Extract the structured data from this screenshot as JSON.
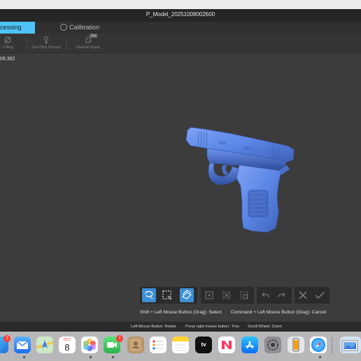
{
  "window": {
    "title": "P_Model_20251008002600"
  },
  "tabs": [
    {
      "label": "cessing",
      "active": true
    },
    {
      "label": "Calibration",
      "icon": "crosshair-icon",
      "active": false
    }
  ],
  "ribbon": {
    "items": [
      {
        "label": "Hole Filling",
        "icon": "hole-filling-icon",
        "visible_label": "l Filling"
      },
      {
        "label": "One-Click Process",
        "icon": "one-click-icon"
      },
      {
        "label": "Head AI Repair",
        "icon": "head-ai-repair-icon",
        "tag": "Test"
      }
    ]
  },
  "viewport": {
    "point_count": "09,362",
    "model": "pistol-mesh"
  },
  "select_toolbar": {
    "tools": [
      "lasso-select-icon",
      "rect-select-icon",
      "through-select-icon",
      "select-connected-icon",
      "deselect-icon",
      "delete-selection-icon",
      "undo-icon",
      "redo-icon",
      "cancel-icon",
      "confirm-icon"
    ]
  },
  "hints": {
    "select": "Shift + Left Mouse Button (Drag): Select",
    "cancel": "Command + Left Mouse Button (Drag): Cancel"
  },
  "status": {
    "rotate": "Left Mouse Button: Rotate",
    "pan": "Press right mouse button : Pan",
    "zoom": "Scroll Wheel: Zoom"
  },
  "dock": {
    "calendar_month": "OCT",
    "calendar_day": "8",
    "mail_badge": "2",
    "facetime_badge": "1",
    "apps": [
      "finder",
      "mail",
      "maps",
      "calendar",
      "photos",
      "facetime",
      "contacts",
      "reminders",
      "notes",
      "apple-tv",
      "news",
      "app-store",
      "system-settings",
      "iphone-mirroring",
      "safari",
      "preview"
    ]
  },
  "colors": {
    "accent": "#4fc3f7",
    "active_tool": "#3d8fd6",
    "model": "#5b86e6"
  }
}
